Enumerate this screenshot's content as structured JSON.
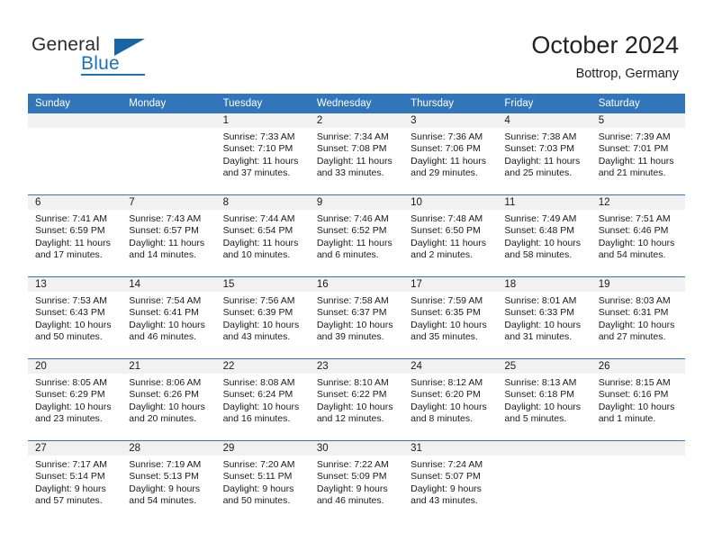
{
  "brand": {
    "name_top": "General",
    "name_bottom": "Blue",
    "flag_icon": "triangle-flag-icon",
    "accent_color": "#1a72bb"
  },
  "header": {
    "title": "October 2024",
    "subtitle": "Bottrop, Germany"
  },
  "colors": {
    "header_blue": "#3275b9",
    "daynum_band": "#f1f1f1",
    "text": "#1a1a1a"
  },
  "weekdays": [
    "Sunday",
    "Monday",
    "Tuesday",
    "Wednesday",
    "Thursday",
    "Friday",
    "Saturday"
  ],
  "weeks": [
    [
      {
        "day": "",
        "empty": true,
        "sunrise": "",
        "sunset": "",
        "daylight_1": "",
        "daylight_2": ""
      },
      {
        "day": "",
        "empty": true,
        "sunrise": "",
        "sunset": "",
        "daylight_1": "",
        "daylight_2": ""
      },
      {
        "day": "1",
        "empty": false,
        "sunrise": "Sunrise: 7:33 AM",
        "sunset": "Sunset: 7:10 PM",
        "daylight_1": "Daylight: 11 hours",
        "daylight_2": "and 37 minutes."
      },
      {
        "day": "2",
        "empty": false,
        "sunrise": "Sunrise: 7:34 AM",
        "sunset": "Sunset: 7:08 PM",
        "daylight_1": "Daylight: 11 hours",
        "daylight_2": "and 33 minutes."
      },
      {
        "day": "3",
        "empty": false,
        "sunrise": "Sunrise: 7:36 AM",
        "sunset": "Sunset: 7:06 PM",
        "daylight_1": "Daylight: 11 hours",
        "daylight_2": "and 29 minutes."
      },
      {
        "day": "4",
        "empty": false,
        "sunrise": "Sunrise: 7:38 AM",
        "sunset": "Sunset: 7:03 PM",
        "daylight_1": "Daylight: 11 hours",
        "daylight_2": "and 25 minutes."
      },
      {
        "day": "5",
        "empty": false,
        "sunrise": "Sunrise: 7:39 AM",
        "sunset": "Sunset: 7:01 PM",
        "daylight_1": "Daylight: 11 hours",
        "daylight_2": "and 21 minutes."
      }
    ],
    [
      {
        "day": "6",
        "empty": false,
        "sunrise": "Sunrise: 7:41 AM",
        "sunset": "Sunset: 6:59 PM",
        "daylight_1": "Daylight: 11 hours",
        "daylight_2": "and 17 minutes."
      },
      {
        "day": "7",
        "empty": false,
        "sunrise": "Sunrise: 7:43 AM",
        "sunset": "Sunset: 6:57 PM",
        "daylight_1": "Daylight: 11 hours",
        "daylight_2": "and 14 minutes."
      },
      {
        "day": "8",
        "empty": false,
        "sunrise": "Sunrise: 7:44 AM",
        "sunset": "Sunset: 6:54 PM",
        "daylight_1": "Daylight: 11 hours",
        "daylight_2": "and 10 minutes."
      },
      {
        "day": "9",
        "empty": false,
        "sunrise": "Sunrise: 7:46 AM",
        "sunset": "Sunset: 6:52 PM",
        "daylight_1": "Daylight: 11 hours",
        "daylight_2": "and 6 minutes."
      },
      {
        "day": "10",
        "empty": false,
        "sunrise": "Sunrise: 7:48 AM",
        "sunset": "Sunset: 6:50 PM",
        "daylight_1": "Daylight: 11 hours",
        "daylight_2": "and 2 minutes."
      },
      {
        "day": "11",
        "empty": false,
        "sunrise": "Sunrise: 7:49 AM",
        "sunset": "Sunset: 6:48 PM",
        "daylight_1": "Daylight: 10 hours",
        "daylight_2": "and 58 minutes."
      },
      {
        "day": "12",
        "empty": false,
        "sunrise": "Sunrise: 7:51 AM",
        "sunset": "Sunset: 6:46 PM",
        "daylight_1": "Daylight: 10 hours",
        "daylight_2": "and 54 minutes."
      }
    ],
    [
      {
        "day": "13",
        "empty": false,
        "sunrise": "Sunrise: 7:53 AM",
        "sunset": "Sunset: 6:43 PM",
        "daylight_1": "Daylight: 10 hours",
        "daylight_2": "and 50 minutes."
      },
      {
        "day": "14",
        "empty": false,
        "sunrise": "Sunrise: 7:54 AM",
        "sunset": "Sunset: 6:41 PM",
        "daylight_1": "Daylight: 10 hours",
        "daylight_2": "and 46 minutes."
      },
      {
        "day": "15",
        "empty": false,
        "sunrise": "Sunrise: 7:56 AM",
        "sunset": "Sunset: 6:39 PM",
        "daylight_1": "Daylight: 10 hours",
        "daylight_2": "and 43 minutes."
      },
      {
        "day": "16",
        "empty": false,
        "sunrise": "Sunrise: 7:58 AM",
        "sunset": "Sunset: 6:37 PM",
        "daylight_1": "Daylight: 10 hours",
        "daylight_2": "and 39 minutes."
      },
      {
        "day": "17",
        "empty": false,
        "sunrise": "Sunrise: 7:59 AM",
        "sunset": "Sunset: 6:35 PM",
        "daylight_1": "Daylight: 10 hours",
        "daylight_2": "and 35 minutes."
      },
      {
        "day": "18",
        "empty": false,
        "sunrise": "Sunrise: 8:01 AM",
        "sunset": "Sunset: 6:33 PM",
        "daylight_1": "Daylight: 10 hours",
        "daylight_2": "and 31 minutes."
      },
      {
        "day": "19",
        "empty": false,
        "sunrise": "Sunrise: 8:03 AM",
        "sunset": "Sunset: 6:31 PM",
        "daylight_1": "Daylight: 10 hours",
        "daylight_2": "and 27 minutes."
      }
    ],
    [
      {
        "day": "20",
        "empty": false,
        "sunrise": "Sunrise: 8:05 AM",
        "sunset": "Sunset: 6:29 PM",
        "daylight_1": "Daylight: 10 hours",
        "daylight_2": "and 23 minutes."
      },
      {
        "day": "21",
        "empty": false,
        "sunrise": "Sunrise: 8:06 AM",
        "sunset": "Sunset: 6:26 PM",
        "daylight_1": "Daylight: 10 hours",
        "daylight_2": "and 20 minutes."
      },
      {
        "day": "22",
        "empty": false,
        "sunrise": "Sunrise: 8:08 AM",
        "sunset": "Sunset: 6:24 PM",
        "daylight_1": "Daylight: 10 hours",
        "daylight_2": "and 16 minutes."
      },
      {
        "day": "23",
        "empty": false,
        "sunrise": "Sunrise: 8:10 AM",
        "sunset": "Sunset: 6:22 PM",
        "daylight_1": "Daylight: 10 hours",
        "daylight_2": "and 12 minutes."
      },
      {
        "day": "24",
        "empty": false,
        "sunrise": "Sunrise: 8:12 AM",
        "sunset": "Sunset: 6:20 PM",
        "daylight_1": "Daylight: 10 hours",
        "daylight_2": "and 8 minutes."
      },
      {
        "day": "25",
        "empty": false,
        "sunrise": "Sunrise: 8:13 AM",
        "sunset": "Sunset: 6:18 PM",
        "daylight_1": "Daylight: 10 hours",
        "daylight_2": "and 5 minutes."
      },
      {
        "day": "26",
        "empty": false,
        "sunrise": "Sunrise: 8:15 AM",
        "sunset": "Sunset: 6:16 PM",
        "daylight_1": "Daylight: 10 hours",
        "daylight_2": "and 1 minute."
      }
    ],
    [
      {
        "day": "27",
        "empty": false,
        "sunrise": "Sunrise: 7:17 AM",
        "sunset": "Sunset: 5:14 PM",
        "daylight_1": "Daylight: 9 hours",
        "daylight_2": "and 57 minutes."
      },
      {
        "day": "28",
        "empty": false,
        "sunrise": "Sunrise: 7:19 AM",
        "sunset": "Sunset: 5:13 PM",
        "daylight_1": "Daylight: 9 hours",
        "daylight_2": "and 54 minutes."
      },
      {
        "day": "29",
        "empty": false,
        "sunrise": "Sunrise: 7:20 AM",
        "sunset": "Sunset: 5:11 PM",
        "daylight_1": "Daylight: 9 hours",
        "daylight_2": "and 50 minutes."
      },
      {
        "day": "30",
        "empty": false,
        "sunrise": "Sunrise: 7:22 AM",
        "sunset": "Sunset: 5:09 PM",
        "daylight_1": "Daylight: 9 hours",
        "daylight_2": "and 46 minutes."
      },
      {
        "day": "31",
        "empty": false,
        "sunrise": "Sunrise: 7:24 AM",
        "sunset": "Sunset: 5:07 PM",
        "daylight_1": "Daylight: 9 hours",
        "daylight_2": "and 43 minutes."
      },
      {
        "day": "",
        "empty": true,
        "sunrise": "",
        "sunset": "",
        "daylight_1": "",
        "daylight_2": ""
      },
      {
        "day": "",
        "empty": true,
        "sunrise": "",
        "sunset": "",
        "daylight_1": "",
        "daylight_2": ""
      }
    ]
  ]
}
